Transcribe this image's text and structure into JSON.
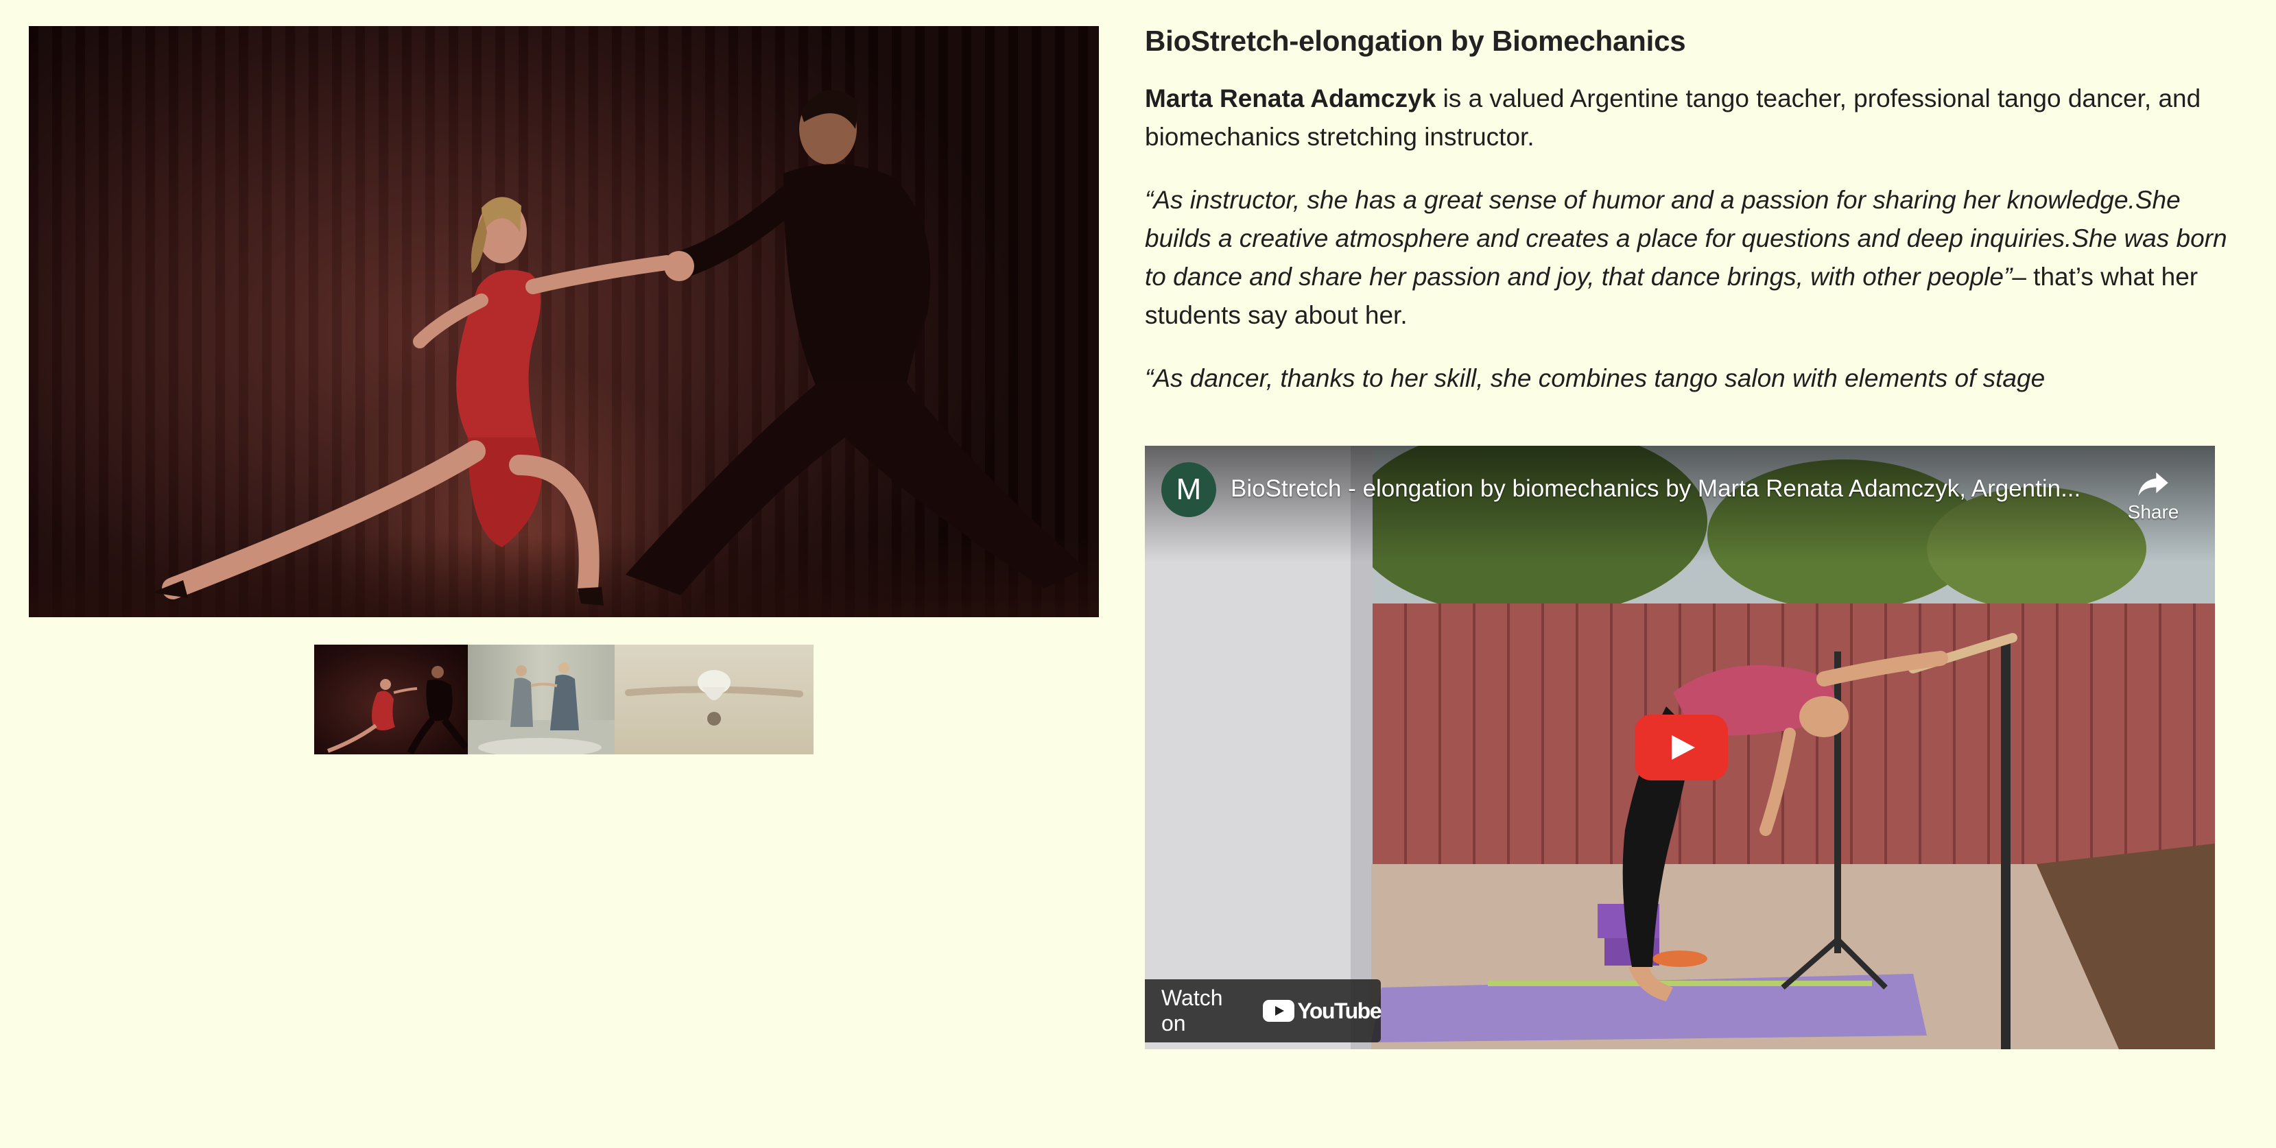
{
  "gallery": {
    "main_image": "tango-couple-photo",
    "thumbnails": [
      "tango-couple-thumbnail",
      "tango-dancers-thumbnail",
      "stretch-floor-thumbnail"
    ]
  },
  "article": {
    "title": "BioStretch-elongation by Biomechanics",
    "intro_name": "Marta Renata Adamczyk",
    "intro_rest": " is a valued Argentine tango teacher, professional tango dancer, and biomechanics stretching instructor.",
    "quote1_italic": "“As instructor, she has a great sense of humor and a passion for sharing her knowledge.She builds a creative atmosphere and creates a place for questions and deep inquiries.She was born to dance and share her passion and joy, that dance brings, with other people”",
    "quote1_rest": "– that’s what her students say about her.",
    "quote2_italic": "“As dancer, thanks to her skill, she combines tango salon with elements of stage"
  },
  "video": {
    "channel_initial": "M",
    "title": "BioStretch - elongation by biomechanics by Marta Renata Adamczyk, Argentin...",
    "share_label": "Share",
    "watch_on_label": "Watch on",
    "platform_name": "YouTube",
    "play_color": "#e9312a"
  },
  "colors": {
    "page_background": "#fdfee6",
    "text": "#1f1f1f"
  }
}
